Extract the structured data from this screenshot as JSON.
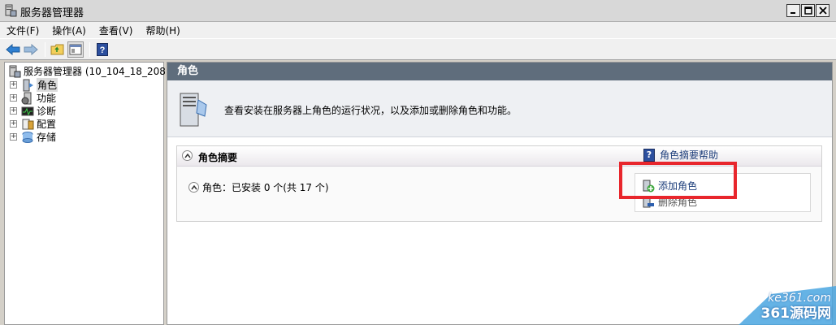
{
  "window": {
    "title": "服务器管理器"
  },
  "menu": [
    "文件(F)",
    "操作(A)",
    "查看(V)",
    "帮助(H)"
  ],
  "tree": {
    "root": "服务器管理器 (10_104_18_208)",
    "items": [
      {
        "label": "角色",
        "icon": "roles-icon"
      },
      {
        "label": "功能",
        "icon": "features-icon"
      },
      {
        "label": "诊断",
        "icon": "diagnostics-icon"
      },
      {
        "label": "配置",
        "icon": "configuration-icon"
      },
      {
        "label": "存储",
        "icon": "storage-icon"
      }
    ]
  },
  "content": {
    "header": "角色",
    "description": "查看安装在服务器上角色的运行状况，以及添加或删除角色和功能。",
    "section": {
      "title": "角色摘要",
      "help_link": "角色摘要帮助",
      "status": "角色：已安装 0 个(共 17 个)",
      "actions": [
        "添加角色",
        "删除角色"
      ]
    }
  },
  "watermark": {
    "site": "ke361.com",
    "name": "361源码网"
  },
  "colors": {
    "header_bg": "#5f6d7c",
    "highlight": "#e8262c",
    "link": "#1c3d7a"
  }
}
